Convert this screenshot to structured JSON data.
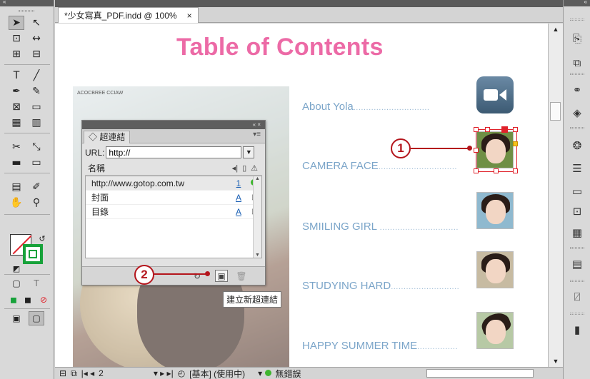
{
  "document": {
    "tab_title": "*少女寫真_PDF.indd @ 100%",
    "close_glyph": "×"
  },
  "page": {
    "title": "Table of Contents",
    "photo_credit": "ACOCBREE CCIAW",
    "entries": [
      {
        "label": "About Yola",
        "dots": "..............................",
        "thumb": "camera-icon"
      },
      {
        "label": "CAMERA FACE",
        "dots": "...............................",
        "thumb": "girl-photo-1"
      },
      {
        "label": "SMIILING GIRL ",
        "dots": "...............................",
        "thumb": "girl-photo-2"
      },
      {
        "label": "STUDYING HARD",
        "dots": "...........................",
        "thumb": "girl-photo-3"
      },
      {
        "label": "HAPPY SUMMER TIME",
        "dots": "................",
        "thumb": "girl-photo-4"
      }
    ]
  },
  "hyperlinks_panel": {
    "collapse_controls": "«  ×",
    "tab_label": "◇ 超連結",
    "menu_glyph": "▾≡",
    "url_label": "URL:",
    "url_value": "http://",
    "column_name": "名稱",
    "links": [
      {
        "name": "http://www.gotop.com.tw",
        "page": "1",
        "status": "ok"
      },
      {
        "name": "封面",
        "page": "A",
        "status": "doc"
      },
      {
        "name": "目錄",
        "page": "A",
        "status": "doc"
      }
    ],
    "tooltip": "建立新超連結"
  },
  "callouts": {
    "one": "1",
    "two": "2"
  },
  "status_bar": {
    "page_field": "2",
    "page_nav": "▾  ▸  ▸|",
    "style_info": "[基本] (使用中)",
    "preflight": "無錯誤"
  }
}
